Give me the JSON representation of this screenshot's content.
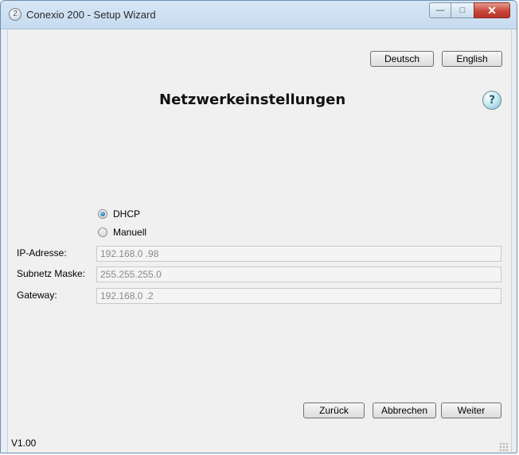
{
  "window": {
    "title": "Conexio 200 - Setup Wizard",
    "app_icon_glyph": "2"
  },
  "caption": {
    "minimize_glyph": "—",
    "maximize_glyph": "□",
    "close_glyph": "✕"
  },
  "language": {
    "deutsch": "Deutsch",
    "english": "English"
  },
  "page": {
    "title": "Netzwerkeinstellungen",
    "help_glyph": "?"
  },
  "network": {
    "mode_options": [
      "DHCP",
      "Manuell"
    ],
    "selected_mode": "DHCP",
    "ip_label": "IP-Adresse:",
    "ip_value": "192.168.0 .98",
    "subnet_label": "Subnetz Maske:",
    "subnet_value": "255.255.255.0",
    "gateway_label": "Gateway:",
    "gateway_value": "192.168.0 .2"
  },
  "footer": {
    "back": "Zurück",
    "cancel": "Abbrechen",
    "next": "Weiter",
    "version": "V1.00"
  },
  "colors": {
    "accent": "#1f74b7",
    "close": "#c9473a"
  },
  "icons": {
    "app": "conexio-icon",
    "help": "help-icon",
    "radio_selected": "radio-selected-icon",
    "resize_grip": "resize-grip-icon"
  }
}
